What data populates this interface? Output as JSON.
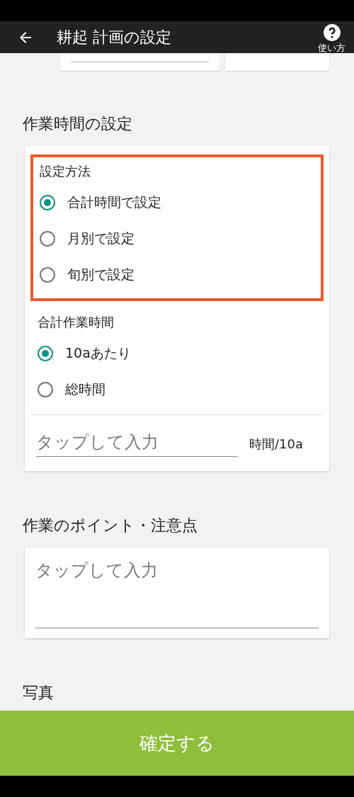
{
  "header": {
    "title": "耕起 計画の設定",
    "help_label": "使い方"
  },
  "top_fields": [
    {
      "kind": "field"
    },
    {
      "kind": "select"
    }
  ],
  "work_time": {
    "title": "作業時間の設定",
    "method": {
      "label": "設定方法",
      "highlighted": true,
      "options": [
        {
          "label": "合計時間で設定",
          "selected": true
        },
        {
          "label": "月別で設定",
          "selected": false
        },
        {
          "label": "旬別で設定",
          "selected": false
        }
      ]
    },
    "total": {
      "label": "合計作業時間",
      "options": [
        {
          "label": "10aあたり",
          "selected": true
        },
        {
          "label": "総時間",
          "selected": false
        }
      ]
    },
    "input": {
      "placeholder": "タップして入力",
      "unit": "時間/10a"
    }
  },
  "points": {
    "title": "作業のポイント・注意点",
    "placeholder": "タップして入力"
  },
  "photo": {
    "title": "写真"
  },
  "confirm_button": "確定する"
}
